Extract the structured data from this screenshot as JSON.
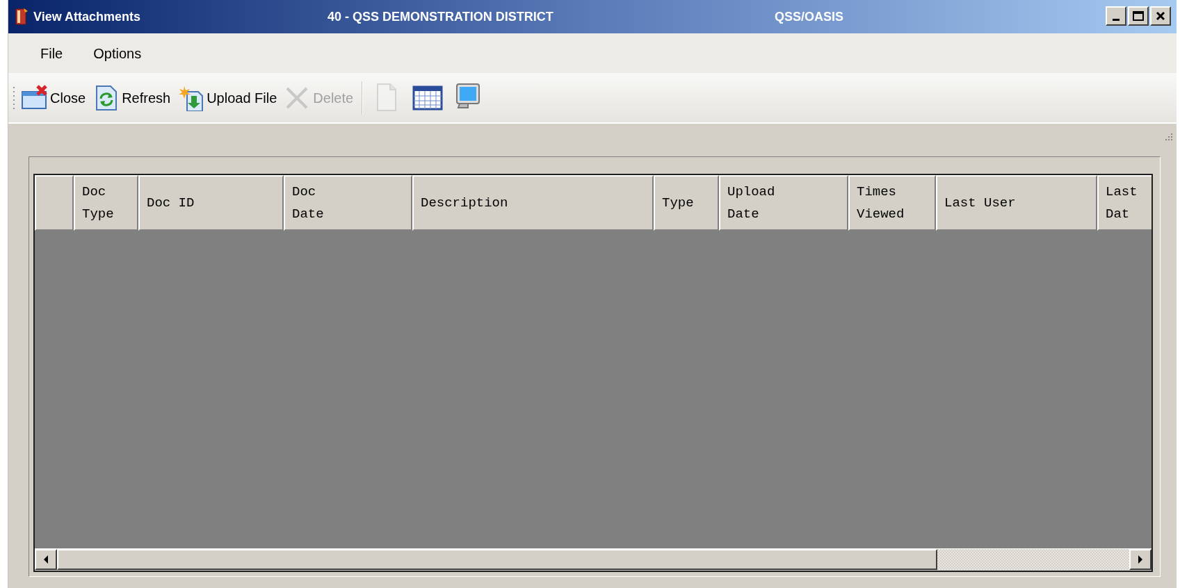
{
  "window": {
    "title": "View Attachments",
    "district": "40 - QSS DEMONSTRATION DISTRICT",
    "system": "QSS/OASIS"
  },
  "menu": [
    "File",
    "Options"
  ],
  "toolbar": {
    "buttons": [
      {
        "label": "Close",
        "disabled": false
      },
      {
        "label": "Refresh",
        "disabled": false
      },
      {
        "label": "Upload File",
        "disabled": false
      },
      {
        "label": "Delete",
        "disabled": true
      }
    ],
    "icon_buttons": [
      {
        "disabled": true
      },
      {
        "disabled": false
      },
      {
        "disabled": false
      }
    ]
  },
  "table": {
    "columns": [
      "Doc Type",
      "Doc ID",
      "Doc Date",
      "Description",
      "Type",
      "Upload Date",
      "Times Viewed",
      "Last User",
      "Last Dat"
    ]
  }
}
